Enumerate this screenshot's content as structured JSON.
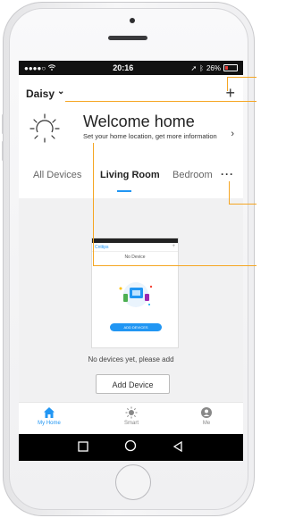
{
  "status_bar": {
    "signal": "●●●●○",
    "time": "20:16",
    "battery": "26%"
  },
  "header": {
    "user_name": "Daisy",
    "user_chevron": "⌄",
    "add_icon": "+"
  },
  "welcome": {
    "title": "Welcome home",
    "subtitle": "Set your home location, get more information",
    "chevron": "›"
  },
  "tabs": {
    "items": [
      "All Devices",
      "Living Room",
      "Bedroom"
    ],
    "active_index": 1,
    "more": "···"
  },
  "empty_state": {
    "thumb_brand": "Cnttips",
    "thumb_plus": "+",
    "thumb_no_device": "No Device",
    "thumb_button": "ADD DEVICES",
    "message": "No devices yet, please add",
    "add_button": "Add Device"
  },
  "bottom_nav": {
    "items": [
      {
        "label": "My Home",
        "icon": "home-icon",
        "active": true
      },
      {
        "label": "Smart",
        "icon": "sun-icon",
        "active": false
      },
      {
        "label": "Me",
        "icon": "person-icon",
        "active": false
      }
    ]
  },
  "android_nav": {
    "back": "◁",
    "home": "○",
    "recents": "□"
  },
  "colors": {
    "accent": "#2196f3",
    "callout": "#f5a623"
  }
}
